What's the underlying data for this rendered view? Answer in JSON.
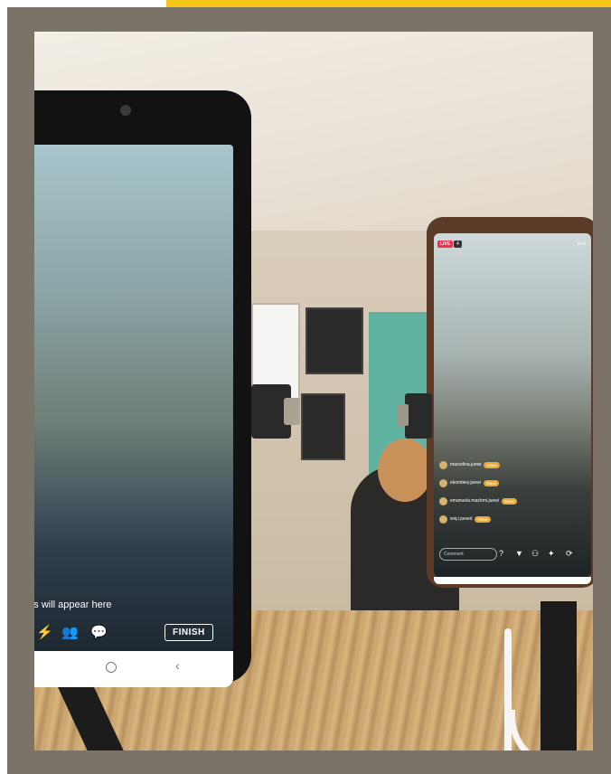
{
  "phone_a": {
    "comment_hint": "ents will appear here",
    "icons": [
      "flash-icon",
      "guest-icon",
      "comment-icon"
    ],
    "finish_label": "FINISH"
  },
  "phone_b": {
    "live_label": "LIVE",
    "viewers_label": "4",
    "end_label": "End",
    "comments": [
      {
        "user": "marcelina.juewi",
        "action": "Wave"
      },
      {
        "user": "ekombiey.juewi",
        "action": "Wave"
      },
      {
        "user": "emanuela.mashrni.juewi",
        "action": "Wave"
      },
      {
        "user": "wiq.i.juwed",
        "action": "Wave"
      }
    ],
    "comment_placeholder": "Comment"
  },
  "colors": {
    "accent": "#f5c518",
    "frame": "#7b7268",
    "live_red": "#e53552",
    "wave_orange": "#e7a93a"
  }
}
